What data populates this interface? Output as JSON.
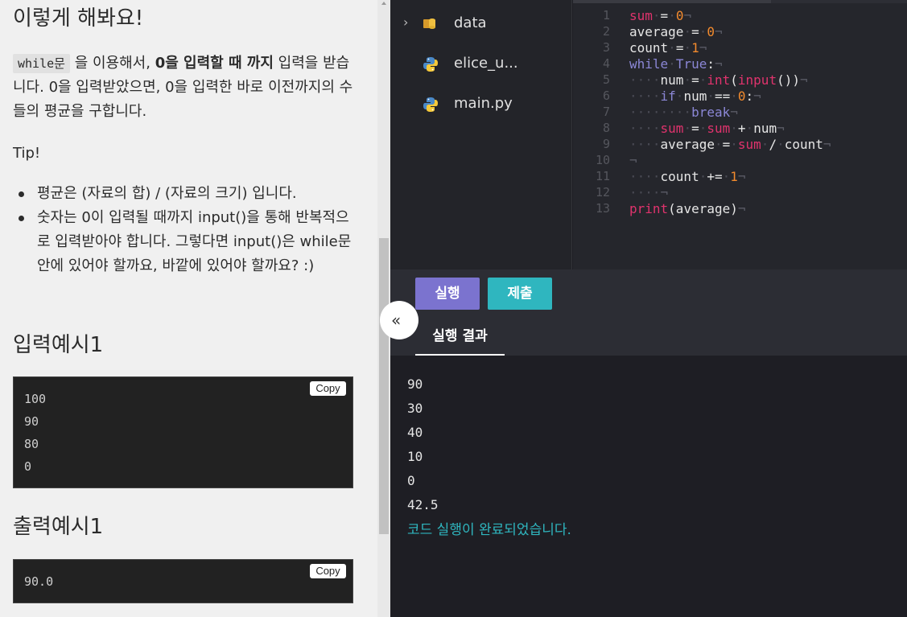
{
  "instructions": {
    "heading": "이렇게 해봐요!",
    "para_code": "while문",
    "para_part1": "을 이용해서,",
    "para_bold": "0을 입력할 때 까지",
    "para_part2": "입력을 받습니다. 0을 입력받았으면, 0을 입력한 바로 이전까지의 수들의 평균을 구합니다.",
    "tip_label": "Tip!",
    "tips": [
      "평균은 (자료의 합) / (자료의 크기) 입니다.",
      "숫자는 0이 입력될 때까지 input()을 통해 반복적으로 입력받아야 합니다. 그렇다면 input()은 while문 안에 있어야 할까요, 바깥에 있어야 할까요? :)"
    ],
    "input_example_title": "입력예시1",
    "input_example_lines": [
      "100",
      "90",
      "80",
      "0"
    ],
    "output_example_title": "출력예시1",
    "output_example_lines": [
      "90.0"
    ],
    "copy_label": "Copy"
  },
  "collapse_label": "«",
  "files": [
    {
      "name": "data",
      "icon": "database-folder-icon"
    },
    {
      "name": "elice_u...",
      "icon": "python-icon"
    },
    {
      "name": "main.py",
      "icon": "python-icon"
    }
  ],
  "editor": {
    "line_numbers": [
      "1",
      "2",
      "3",
      "4",
      "5",
      "6",
      "7",
      "8",
      "9",
      "10",
      "11",
      "12",
      "13"
    ]
  },
  "toolbar": {
    "run_label": "실행",
    "submit_label": "제출"
  },
  "result_tab_label": "실행 결과",
  "output_lines": [
    "90",
    "30",
    "40",
    "10",
    "0",
    "42.5"
  ],
  "output_status": "코드 실행이 완료되었습니다.",
  "colors": {
    "run": "#7b73cf",
    "submit": "#2fb6bf",
    "keyword": "#e0336d",
    "number": "#f28a2d",
    "status": "#2fb6bf"
  }
}
